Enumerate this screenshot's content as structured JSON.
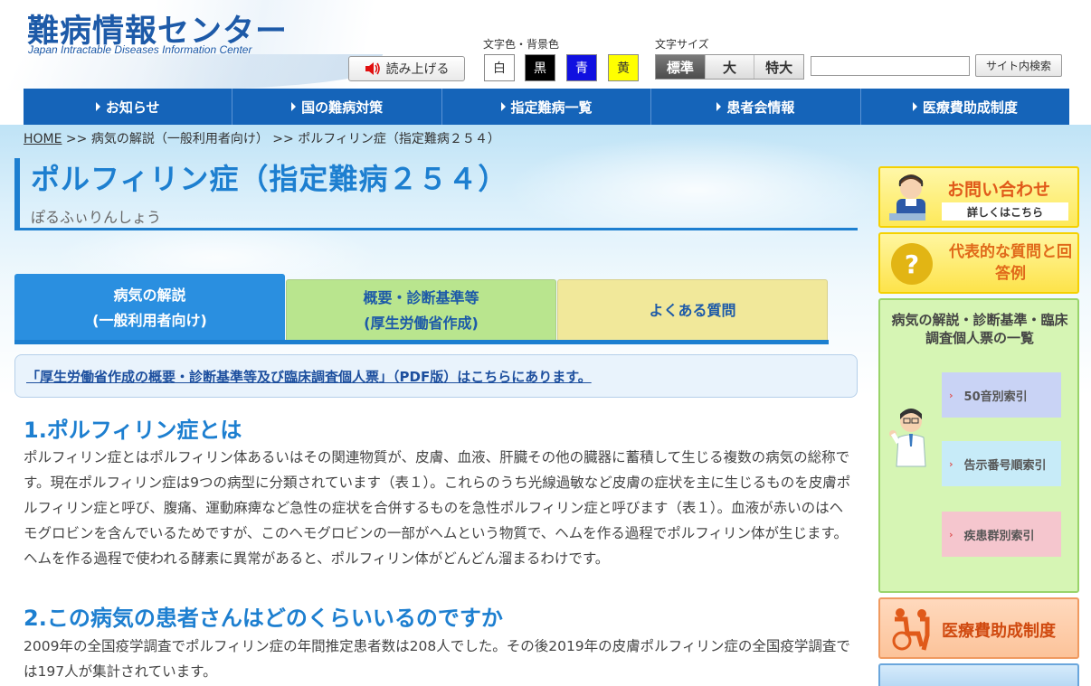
{
  "header": {
    "logo_jp": "難病情報センター",
    "logo_en": "Japan Intractable Diseases Information Center",
    "read_aloud": "読み上げる",
    "color_label": "文字色・背景色",
    "colors": [
      {
        "label": "白",
        "bg": "#ffffff",
        "fg": "#333333"
      },
      {
        "label": "黒",
        "bg": "#000000",
        "fg": "#ffffff"
      },
      {
        "label": "青",
        "bg": "#1010e0",
        "fg": "#ffffff"
      },
      {
        "label": "黄",
        "bg": "#ffff00",
        "fg": "#333333"
      }
    ],
    "size_label": "文字サイズ",
    "sizes": [
      "標準",
      "大",
      "特大"
    ],
    "search_value": "",
    "search_button": "サイト内検索"
  },
  "nav": [
    "お知らせ",
    "国の難病対策",
    "指定難病一覧",
    "患者会情報",
    "医療費助成制度"
  ],
  "breadcrumb": {
    "home": "HOME",
    "rest": " >> 病気の解説（一般利用者向け） >> ポルフィリン症（指定難病２５４）"
  },
  "page": {
    "title": "ポルフィリン症（指定難病２５４）",
    "reading": "ぽるふぃりんしょう"
  },
  "tabs": [
    {
      "line1": "病気の解説",
      "line2": "(一般利用者向け)"
    },
    {
      "line1": "概要・診断基準等",
      "line2": "(厚生労働省作成)"
    },
    {
      "line1": "よくある質問",
      "line2": ""
    }
  ],
  "notice": "「厚生労働省作成の概要・診断基準等及び臨床調査個人票」（PDF版）はこちらにあります。",
  "sections": [
    {
      "heading": "1.ポルフィリン症とは",
      "body": "ポルフィリン症とはポルフィリン体あるいはその関連物質が、皮膚、血液、肝臓その他の臓器に蓄積して生じる複数の病気の総称です。現在ポルフィリン症は9つの病型に分類されています（表１）。これらのうち光線過敏など皮膚の症状を主に生じるものを皮膚ポルフィリン症と呼び、腹痛、運動麻痺など急性の症状を合併するものを急性ポルフィリン症と呼びます（表１）。血液が赤いのはヘモグロビンを含んでいるためですが、このヘモグロビンの一部がヘムという物質で、ヘムを作る過程でポルフィリン体が生じます。ヘムを作る過程で使われる酵素に異常があると、ポルフィリン体がどんどん溜まるわけです。"
    },
    {
      "heading": "2.この病気の患者さんはどのくらいいるのですか",
      "body": "2009年の全国疫学調査でポルフィリン症の年間推定患者数は208人でした。その後2019年の皮膚ポルフィリン症の全国疫学調査では197人が集計されています。"
    }
  ],
  "sidebar": {
    "contact_title": "お問い合わせ",
    "contact_sub": "詳しくはこちら",
    "faq_title": "代表的な質問と回答例",
    "list_title": "病気の解説・診断基準・臨床調査個人票の一覧",
    "indexes": [
      {
        "label": "50音別索引",
        "color": "#c9d3f5"
      },
      {
        "label": "告示番号順索引",
        "color": "#c7ebf8"
      },
      {
        "label": "疾患群別索引",
        "color": "#f5c6ce"
      }
    ],
    "medical": "医療費助成制度"
  }
}
